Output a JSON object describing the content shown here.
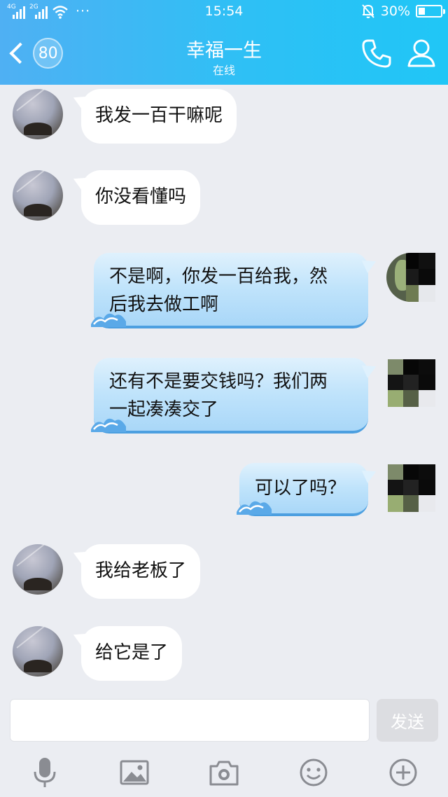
{
  "status_bar": {
    "signal_1": "4G",
    "signal_2": "2G",
    "more": "···",
    "time": "15:54",
    "battery_text": "30%"
  },
  "header": {
    "unread_count": "80",
    "title": "幸福一生",
    "subtitle": "在线"
  },
  "messages": [
    {
      "direction": "in",
      "text_lines": [
        "我发一百干嘛呢"
      ]
    },
    {
      "direction": "in",
      "text_lines": [
        "你没看懂吗"
      ]
    },
    {
      "direction": "out",
      "text_lines": [
        "不是啊，你发一百给我，然",
        "后我去做工啊"
      ]
    },
    {
      "direction": "out",
      "text_lines": [
        "还有不是要交钱吗？我们两",
        "一起凑凑交了"
      ]
    },
    {
      "direction": "out",
      "text_lines": [
        "可以了吗？"
      ]
    },
    {
      "direction": "in",
      "text_lines": [
        "我给老板了"
      ]
    },
    {
      "direction": "in",
      "text_lines": [
        "给它是了"
      ]
    }
  ],
  "input": {
    "value": "",
    "placeholder": "",
    "send_label": "发送"
  },
  "toolbar": {
    "items": [
      "microphone-icon",
      "image-icon",
      "camera-icon",
      "emoji-icon",
      "plus-icon"
    ]
  },
  "colors": {
    "header_start": "#4fb0f3",
    "header_end": "#20c6f6",
    "background": "#ebedf2",
    "outgoing_bubble": "#bfe3fb",
    "incoming_bubble": "#ffffff",
    "icon_gray": "#8a8c92"
  }
}
